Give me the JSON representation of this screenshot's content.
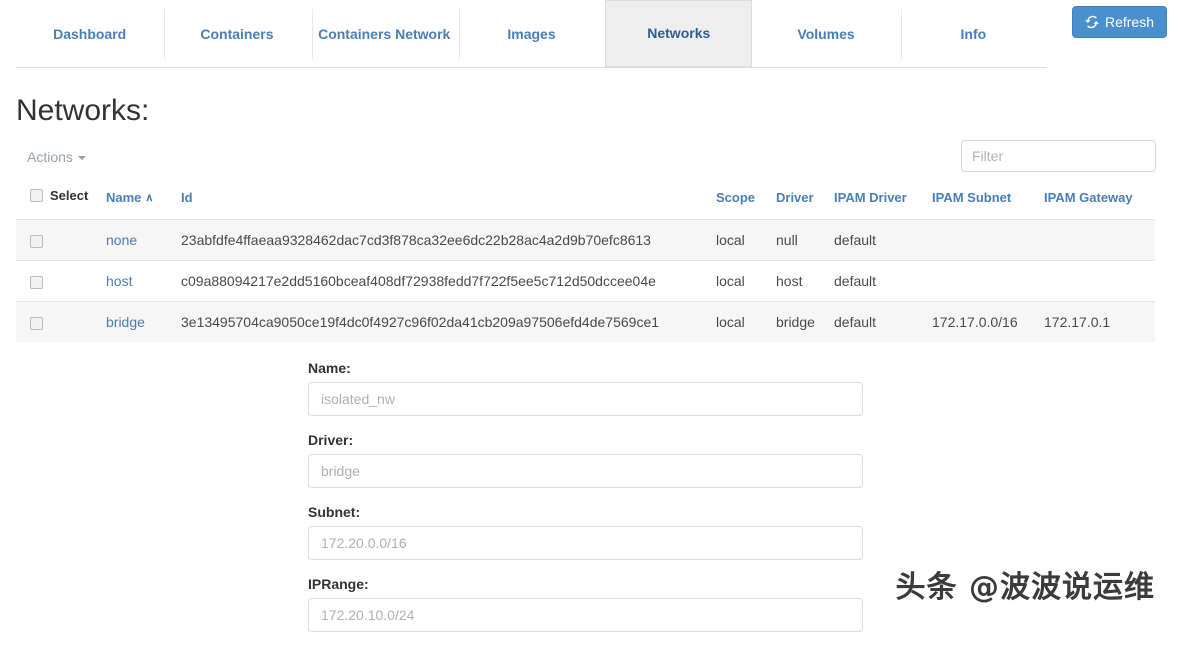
{
  "nav": {
    "tabs": [
      {
        "label": "Dashboard",
        "active": false
      },
      {
        "label": "Containers",
        "active": false
      },
      {
        "label": "Containers Network",
        "active": false
      },
      {
        "label": "Images",
        "active": false
      },
      {
        "label": "Networks",
        "active": true
      },
      {
        "label": "Volumes",
        "active": false
      },
      {
        "label": "Info",
        "active": false
      }
    ],
    "refresh_label": "Refresh",
    "refresh_icon": "refresh-icon",
    "refresh_color": "#4a90cf"
  },
  "page": {
    "title": "Networks:"
  },
  "toolbar": {
    "actions_label": "Actions",
    "actions_caret_icon": "caret-down-icon",
    "filter_placeholder": "Filter",
    "filter_value": ""
  },
  "table": {
    "select_label": "Select",
    "sort_column": "Name",
    "sort_caret_icon": "caret-up-icon",
    "sort_caret_glyph": "∧",
    "columns": [
      {
        "key": "name",
        "label": "Name"
      },
      {
        "key": "id",
        "label": "Id"
      },
      {
        "key": "scope",
        "label": "Scope"
      },
      {
        "key": "driver",
        "label": "Driver"
      },
      {
        "key": "ipam_driver",
        "label": "IPAM Driver"
      },
      {
        "key": "ipam_subnet",
        "label": "IPAM Subnet"
      },
      {
        "key": "ipam_gateway",
        "label": "IPAM Gateway"
      }
    ],
    "rows": [
      {
        "name": "none",
        "id": "23abfdfe4ffaeaa9328462dac7cd3f878ca32ee6dc22b28ac4a2d9b70efc8613",
        "scope": "local",
        "driver": "null",
        "ipam_driver": "default",
        "ipam_subnet": "",
        "ipam_gateway": "",
        "selected": false,
        "striped": true
      },
      {
        "name": "host",
        "id": "c09a88094217e2dd5160bceaf408df72938fedd7f722f5ee5c712d50dccee04e",
        "scope": "local",
        "driver": "host",
        "ipam_driver": "default",
        "ipam_subnet": "",
        "ipam_gateway": "",
        "selected": false,
        "striped": false
      },
      {
        "name": "bridge",
        "id": "3e13495704ca9050ce19f4dc0f4927c96f02da41cb209a97506efd4de7569ce1",
        "scope": "local",
        "driver": "bridge",
        "ipam_driver": "default",
        "ipam_subnet": "172.17.0.0/16",
        "ipam_gateway": "172.17.0.1",
        "selected": false,
        "striped": true
      }
    ]
  },
  "form": {
    "fields": [
      {
        "label": "Name:",
        "placeholder": "isolated_nw",
        "value": ""
      },
      {
        "label": "Driver:",
        "placeholder": "bridge",
        "value": ""
      },
      {
        "label": "Subnet:",
        "placeholder": "172.20.0.0/16",
        "value": ""
      },
      {
        "label": "IPRange:",
        "placeholder": "172.20.10.0/24",
        "value": ""
      }
    ]
  },
  "watermark": {
    "text": "头条 @波波说运维"
  }
}
